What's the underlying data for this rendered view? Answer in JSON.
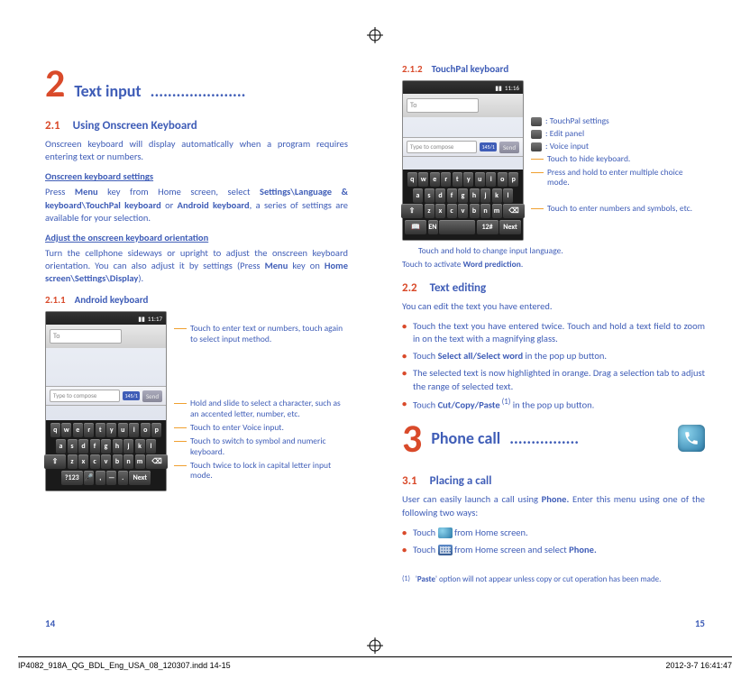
{
  "chapter2": {
    "num": "2",
    "title": "Text input",
    "dots": "......................"
  },
  "sec21": {
    "num": "2.1",
    "title": "Using Onscreen Keyboard",
    "intro": "Onscreen keyboard will display automatically when a program requires entering text or numbers.",
    "sub1_head": "Onscreen keyboard settings",
    "sub1_body_a": "Press ",
    "sub1_body_b": "Menu",
    "sub1_body_c": " key from Home screen, select ",
    "sub1_body_d": "Settings\\Language & keyboard\\TouchPal keyboard",
    "sub1_body_e": " or ",
    "sub1_body_f": "Android keyboard",
    "sub1_body_g": ", a series of settings are available for your selection.",
    "sub2_head": "Adjust the onscreen keyboard orientation",
    "sub2_body_a": "Turn the cellphone sideways or upright to adjust the onscreen keyboard orientation. You can also adjust it by settings (Press ",
    "sub2_body_b": "Menu",
    "sub2_body_c": " key on ",
    "sub2_body_d": "Home screen\\Settings\\Display",
    "sub2_body_e": ")."
  },
  "sec211": {
    "num": "2.1.1",
    "title": "Android keyboard",
    "time": "11:17",
    "to_label": "To",
    "compose_placeholder": "Type to compose",
    "char_count": "145/1",
    "send": "Send",
    "keys_r1": [
      "q",
      "w",
      "e",
      "r",
      "t",
      "y",
      "u",
      "i",
      "o",
      "p"
    ],
    "keys_r2": [
      "a",
      "s",
      "d",
      "f",
      "g",
      "h",
      "j",
      "k",
      "l"
    ],
    "keys_r3": [
      "⇧",
      "z",
      "x",
      "c",
      "v",
      "b",
      "n",
      "m",
      "⌫"
    ],
    "keys_r4": [
      "?123",
      "🎤",
      ",",
      "—",
      ".",
      "Next"
    ],
    "annot1": "Touch to enter text or numbers, touch again to select input method.",
    "annot2": "Hold and slide to select a character, such as an accented letter, number, etc.",
    "annot3": "Touch to enter Voice input.",
    "annot4": "Touch to switch to symbol and numeric keyboard.",
    "annot5": "Touch twice to lock in capital letter input mode."
  },
  "sec212": {
    "num": "2.1.2",
    "title": "TouchPal keyboard",
    "time": "11:16",
    "to_label": "To",
    "compose_placeholder": "Type to compose",
    "char_count": "145/1",
    "send": "Send",
    "keys_r1": [
      "q",
      "w",
      "e",
      "r",
      "t",
      "y",
      "u",
      "i",
      "o",
      "p"
    ],
    "keys_r2": [
      "a",
      "s",
      "d",
      "f",
      "g",
      "h",
      "j",
      "k",
      "l"
    ],
    "keys_r3": [
      "⇧",
      "z",
      "x",
      "c",
      "v",
      "b",
      "n",
      "m",
      "⌫"
    ],
    "keys_r4": [
      "📖",
      "EN",
      "",
      "12#",
      "Next"
    ],
    "legend1": ": TouchPal settings",
    "legend2": ": Edit panel",
    "legend3": ": Voice input",
    "annot1": "Touch to hide keyboard.",
    "annot2": "Press and hold to enter multiple choice mode.",
    "annot3": "Touch to enter numbers and symbols, etc.",
    "caption1": "Touch and hold to change input language.",
    "caption2_a": "Touch to activate ",
    "caption2_b": "Word prediction",
    "caption2_c": "."
  },
  "sec22": {
    "num": "2.2",
    "title": "Text editing",
    "intro": "You can edit the text you have entered.",
    "b1": "Touch the text you have entered twice. Touch and hold a text field to zoom in on the text with a magnifying glass.",
    "b2_a": "Touch ",
    "b2_b": "Select all/Select word",
    "b2_c": " in the pop up button.",
    "b3": "The selected text is now highlighted in orange. Drag a selection tab  to adjust the range of selected text.",
    "b4_a": "Touch ",
    "b4_b": "Cut/Copy/Paste",
    "b4_sup": " (1)",
    "b4_c": " in the pop up button."
  },
  "chapter3": {
    "num": "3",
    "title": "Phone call",
    "dots": "................"
  },
  "sec31": {
    "num": "3.1",
    "title": "Placing a call",
    "intro_a": "User can easily launch a call using ",
    "intro_b": "Phone.",
    "intro_c": " Enter this menu using one of the following two ways:",
    "b1_a": "Touch ",
    "b1_b": " from Home screen.",
    "b2_a": "Touch ",
    "b2_b": " from Home screen and select ",
    "b2_c": "Phone."
  },
  "footnote": {
    "marker": "(1)",
    "text_a": "'",
    "text_b": "Paste",
    "text_c": "' option will not appear unless copy or cut operation has been made."
  },
  "pagenum_left": "14",
  "pagenum_right": "15",
  "footer": {
    "file": "IP4082_918A_QG_BDL_Eng_USA_08_120307.indd   14-15",
    "date": "2012-3-7   16:41:47"
  }
}
